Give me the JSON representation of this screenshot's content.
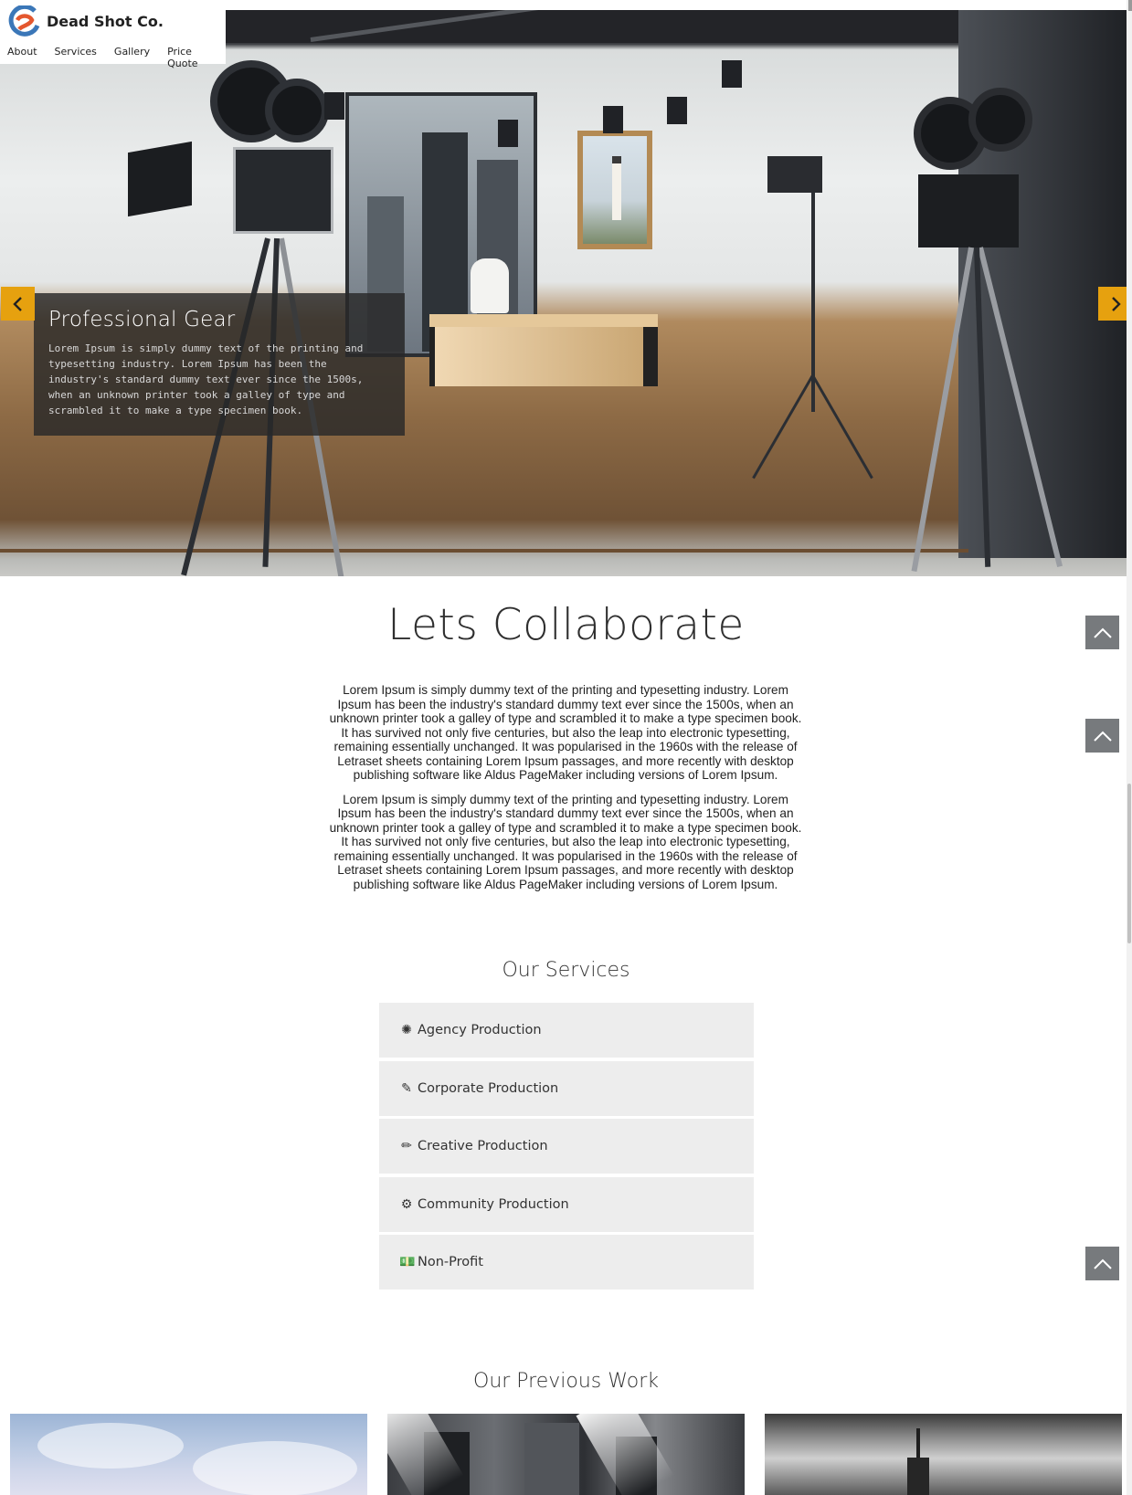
{
  "brand": {
    "name": "Dead Shot Co."
  },
  "nav": {
    "items": [
      "About",
      "Services",
      "Gallery",
      "Price Quote"
    ]
  },
  "hero": {
    "caption_title": "Professional Gear",
    "caption_text": "Lorem Ipsum is simply dummy text of the printing and typesetting industry. Lorem Ipsum has been the industry's standard dummy text ever since the 1500s, when an unknown printer took a galley of type and scrambled it to make a type specimen book."
  },
  "collaborate": {
    "title": "Lets Collaborate",
    "paragraphs": [
      "Lorem Ipsum is simply dummy text of the printing and typesetting industry. Lorem Ipsum has been the industry's standard dummy text ever since the 1500s, when an unknown printer took a galley of type and scrambled it to make a type specimen book. It has survived not only five centuries, but also the leap into electronic typesetting, remaining essentially unchanged. It was popularised in the 1960s with the release of Letraset sheets containing Lorem Ipsum passages, and more recently with desktop publishing software like Aldus PageMaker including versions of Lorem Ipsum.",
      "Lorem Ipsum is simply dummy text of the printing and typesetting industry. Lorem Ipsum has been the industry's standard dummy text ever since the 1500s, when an unknown printer took a galley of type and scrambled it to make a type specimen book. It has survived not only five centuries, but also the leap into electronic typesetting, remaining essentially unchanged. It was popularised in the 1960s with the release of Letraset sheets containing Lorem Ipsum passages, and more recently with desktop publishing software like Aldus PageMaker including versions of Lorem Ipsum."
    ]
  },
  "services": {
    "title": "Our Services",
    "items": [
      {
        "label": "Agency Production",
        "icon": "asterisk-icon",
        "glyph": "✺"
      },
      {
        "label": "Corporate Production",
        "icon": "brush-icon",
        "glyph": "✎"
      },
      {
        "label": "Creative Production",
        "icon": "pencil-icon",
        "glyph": "✏"
      },
      {
        "label": "Community Production",
        "icon": "cogs-icon",
        "glyph": "⚙"
      },
      {
        "label": "Non-Profit",
        "icon": "money-icon",
        "glyph": "💵"
      }
    ]
  },
  "gallery": {
    "title": "Our Previous Work"
  },
  "colors": {
    "accent": "#e6a10f",
    "to_top": "#777a7d",
    "service_bg": "#ededed"
  }
}
